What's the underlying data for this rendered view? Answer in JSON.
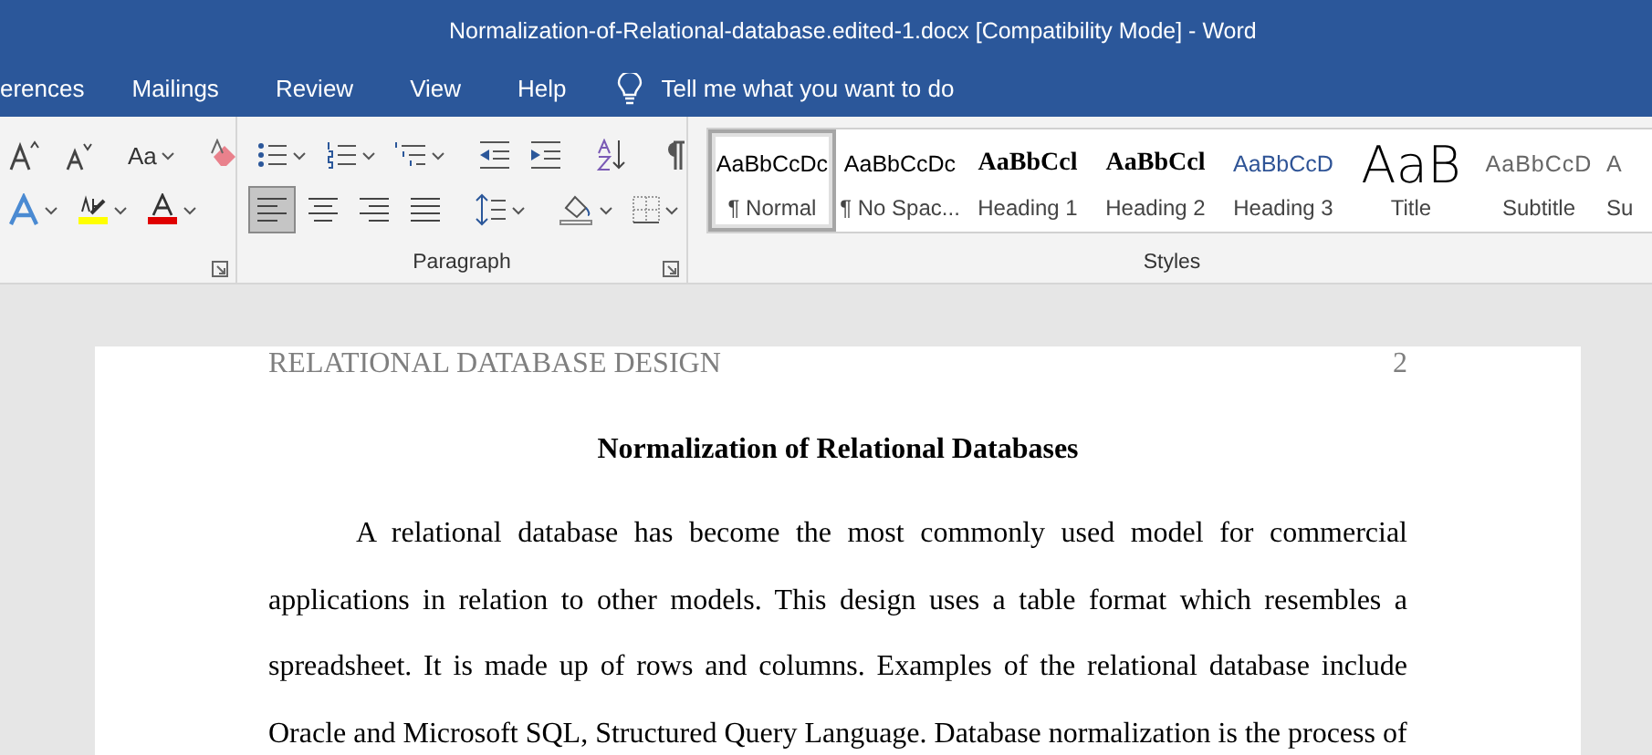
{
  "window": {
    "title": "Normalization-of-Relational-database.edited-1.docx [Compatibility Mode]  -  Word"
  },
  "tabs": [
    {
      "label": "erences",
      "selected": false
    },
    {
      "label": "Mailings",
      "selected": false
    },
    {
      "label": "Review",
      "selected": false
    },
    {
      "label": "View",
      "selected": false
    },
    {
      "label": "Help",
      "selected": false
    }
  ],
  "tell_me": {
    "placeholder": "Tell me what you want to do"
  },
  "ribbon": {
    "font_group": {
      "font_size_label": "Aa"
    },
    "paragraph_group": {
      "label": "Paragraph",
      "alignment_buttons": [
        {
          "selected": true
        },
        {
          "selected": false
        },
        {
          "selected": false
        },
        {
          "selected": false
        }
      ]
    },
    "styles_group": {
      "label": "Styles",
      "styles": [
        {
          "sample": "AaBbCcDc",
          "name": "¶ Normal",
          "kind": "normal",
          "selected": true
        },
        {
          "sample": "AaBbCcDc",
          "name": "¶ No Spac...",
          "kind": "normal",
          "selected": false
        },
        {
          "sample": "AaBbCcl",
          "name": "Heading 1",
          "kind": "heading",
          "selected": false
        },
        {
          "sample": "AaBbCcl",
          "name": "Heading 2",
          "kind": "heading",
          "selected": false
        },
        {
          "sample": "AaBbCcD",
          "name": "Heading 3",
          "kind": "heading3",
          "selected": false
        },
        {
          "sample": "AaB",
          "name": "Title",
          "kind": "title",
          "selected": false
        },
        {
          "sample": "AaBbCcD",
          "name": "Subtitle",
          "kind": "subtitle",
          "selected": false
        },
        {
          "sample": "A",
          "name": "Su",
          "kind": "subtitle",
          "selected": false
        }
      ]
    }
  },
  "document": {
    "header": "RELATIONAL DATABASE DESIGN",
    "page_number": "2",
    "heading": "Normalization of Relational Databases",
    "paragraph": "A relational database has become the most commonly used model for commercial applications in relation to other models. This design uses a table format which resembles a spreadsheet. It is made up of rows and columns. Examples of the relational database include Oracle and Microsoft SQL, Structured Query Language. Database normalization is the process of"
  }
}
